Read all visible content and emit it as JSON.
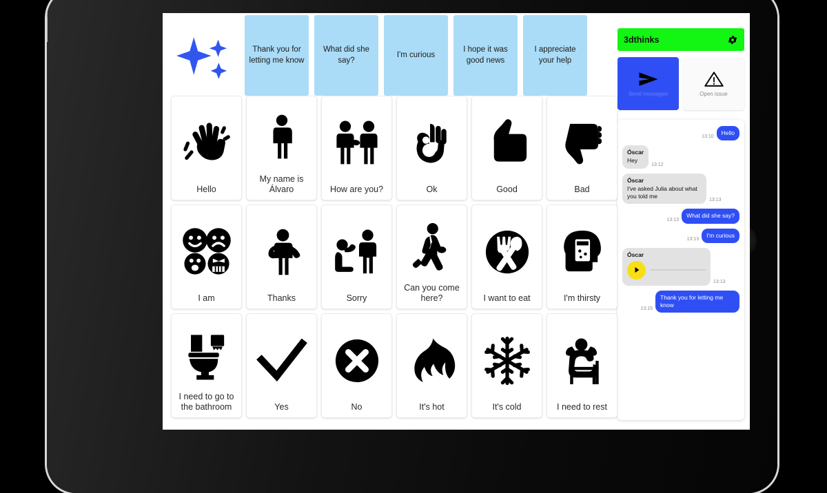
{
  "app": {
    "title": "3dthinks",
    "gear_icon": "gear-icon"
  },
  "actions": [
    {
      "id": "send-messages",
      "label": "Send messages",
      "icon": "send-paper-plane-icon",
      "accent": "#2f4ff5"
    },
    {
      "id": "open-issue",
      "label": "Open issue",
      "icon": "warning-triangle-icon",
      "accent": "#fafafa"
    }
  ],
  "suggestions": {
    "sparkle_icon": "sparkles-icon",
    "accent": "#aadcf7",
    "items": [
      "Thank you for letting me know",
      "What did she say?",
      "I'm curious",
      "I hope it was good news",
      "I appreciate your help"
    ]
  },
  "symbols": [
    {
      "label": "Hello",
      "icon": "waving-hand-icon"
    },
    {
      "label": "My name is Álvaro",
      "icon": "person-self-icon"
    },
    {
      "label": "How are you?",
      "icon": "two-people-greeting-icon"
    },
    {
      "label": "Ok",
      "icon": "ok-hand-icon"
    },
    {
      "label": "Good",
      "icon": "thumbs-up-icon"
    },
    {
      "label": "Bad",
      "icon": "thumbs-down-icon"
    },
    {
      "label": "I am",
      "icon": "four-emotion-faces-icon"
    },
    {
      "label": "Thanks",
      "icon": "person-bowing-thanks-icon"
    },
    {
      "label": "Sorry",
      "icon": "person-kneeling-apology-icon"
    },
    {
      "label": "Can you come here?",
      "icon": "person-walking-icon"
    },
    {
      "label": "I want to eat",
      "icon": "fork-and-spoon-icon"
    },
    {
      "label": "I'm thirsty",
      "icon": "head-with-glass-icon"
    },
    {
      "label": "I need to go to the bathroom",
      "icon": "toilet-icon"
    },
    {
      "label": "Yes",
      "icon": "checkmark-icon"
    },
    {
      "label": "No",
      "icon": "circle-x-icon"
    },
    {
      "label": "It's hot",
      "icon": "flame-icon"
    },
    {
      "label": "It's cold",
      "icon": "snowflake-icon"
    },
    {
      "label": "I need to rest",
      "icon": "person-resting-chair-icon"
    }
  ],
  "chat": {
    "messages": [
      {
        "direction": "out",
        "sender": "",
        "text": "Hello",
        "time": "13:10",
        "type": "text"
      },
      {
        "direction": "in",
        "sender": "Óscar",
        "text": "Hey",
        "time": "13:12",
        "type": "text"
      },
      {
        "direction": "in",
        "sender": "Óscar",
        "text": "I've asked Julia about what you told me",
        "time": "13:13",
        "type": "text"
      },
      {
        "direction": "out",
        "sender": "",
        "text": "What did she say?",
        "time": "13:13",
        "type": "text"
      },
      {
        "direction": "out",
        "sender": "",
        "text": "I'm curious",
        "time": "13:13",
        "type": "text"
      },
      {
        "direction": "in",
        "sender": "Óscar",
        "text": "",
        "time": "13:13",
        "type": "voice"
      },
      {
        "direction": "out",
        "sender": "",
        "text": "Thank you for letting me know",
        "time": "13:15",
        "type": "text"
      }
    ]
  }
}
